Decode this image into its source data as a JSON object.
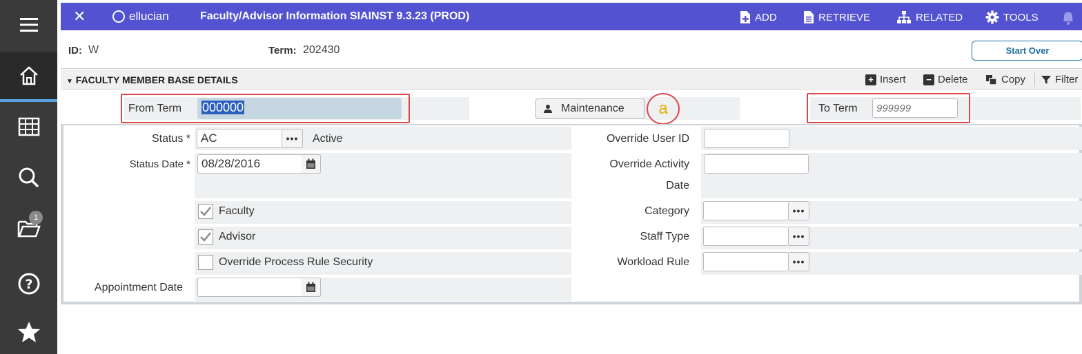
{
  "nav": {
    "items": [
      {
        "name": "menu"
      },
      {
        "name": "home"
      },
      {
        "name": "applications"
      },
      {
        "name": "search"
      },
      {
        "name": "recently-opened",
        "badge": "1"
      },
      {
        "name": "help"
      },
      {
        "name": "favorites"
      }
    ]
  },
  "header": {
    "close": "✕",
    "brand": "ellucian",
    "title": "Faculty/Advisor Information SIAINST 9.3.23 (PROD)",
    "actions": {
      "add": "ADD",
      "retrieve": "RETRIEVE",
      "related": "RELATED",
      "tools": "TOOLS"
    }
  },
  "key": {
    "id_label": "ID:",
    "id_value": "W",
    "term_label": "Term:",
    "term_value": "202430",
    "start_over": "Start Over"
  },
  "section": {
    "title": "FACULTY MEMBER BASE DETAILS",
    "insert": "Insert",
    "delete": "Delete",
    "copy": "Copy",
    "filter": "Filter"
  },
  "term_row": {
    "from_label": "From Term",
    "from_value": "000000",
    "maintenance": "Maintenance",
    "annotation": "a",
    "to_label": "To Term",
    "to_placeholder": "999999"
  },
  "form": {
    "status_label": "Status *",
    "status_value": "AC",
    "status_desc": "Active",
    "status_date_label": "Status Date *",
    "status_date_value": "08/28/2016",
    "faculty_label": "Faculty",
    "advisor_label": "Advisor",
    "override_process_label": "Override Process Rule Security",
    "appointment_label": "Appointment Date",
    "override_user_label": "Override User ID",
    "override_activity_label_1": "Override Activity",
    "override_activity_label_2": "Date",
    "category_label": "Category",
    "staff_type_label": "Staff Type",
    "workload_label": "Workload Rule",
    "lookup": "•••"
  },
  "colors": {
    "header_bg": "#5353d1",
    "nav_bg": "#3a3a3a",
    "annotation_red": "#e04848",
    "accent_blue": "#1c6ea4"
  }
}
